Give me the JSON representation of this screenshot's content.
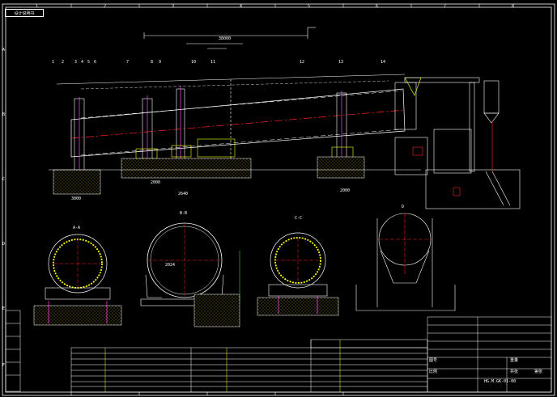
{
  "drawing": {
    "title_stamp": "设计说明书",
    "column_labels": [
      "1",
      "2",
      "3",
      "4",
      "5",
      "6",
      "7",
      "8"
    ],
    "row_labels": [
      "A",
      "B",
      "C",
      "D",
      "E",
      "F"
    ],
    "section_labels": [
      "A-A",
      "B-B",
      "C-C",
      "D"
    ],
    "item_numbers": [
      "1",
      "2",
      "3",
      "4",
      "5",
      "6",
      "7",
      "8",
      "9",
      "10",
      "11",
      "12",
      "13",
      "14"
    ],
    "dimensions": {
      "top_overall": "38000",
      "span_a": "2000",
      "span_b": "2640",
      "base_a": "3000",
      "base_b": "2000",
      "section_b_dia": "2024"
    },
    "drawing_number": "HG.M.GK-01-00",
    "title_cells": [
      "图号",
      "比例",
      "重量",
      "共张",
      "第张"
    ]
  },
  "colors": {
    "background": "#000000",
    "frame": "#ffffff",
    "drum": "#ffffff",
    "center_line": "#ff2020",
    "dimension": "#00e5e5",
    "steel": "#ffff00",
    "hatching": "#e0d060",
    "accent": "#ff40ff",
    "table_text": "#00ff00",
    "leader": "#40ff40"
  }
}
